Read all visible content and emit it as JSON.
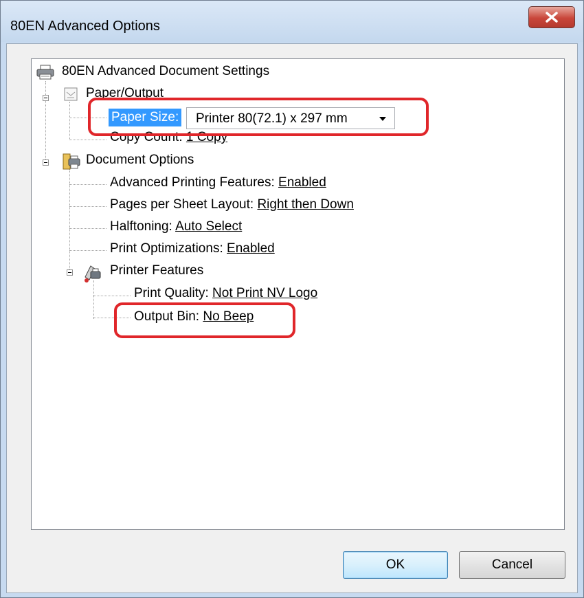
{
  "window": {
    "title": "80EN Advanced Options",
    "close_icon": "close-icon"
  },
  "tree": {
    "root": {
      "label": "80EN Advanced Document Settings",
      "icon": "printer-icon"
    },
    "paper_output": {
      "label": "Paper/Output",
      "icon": "paper-icon",
      "paper_size": {
        "label": "Paper Size:",
        "value": "Printer 80(72.1) x 297 mm"
      },
      "copy_count": {
        "label": "Copy Count:",
        "value": "1 Copy"
      }
    },
    "document_options": {
      "label": "Document Options",
      "icon": "document-options-icon",
      "items": [
        {
          "label": "Advanced Printing Features:",
          "value": "Enabled"
        },
        {
          "label": "Pages per Sheet Layout:",
          "value": "Right then Down"
        },
        {
          "label": "Halftoning:",
          "value": "Auto Select"
        },
        {
          "label": "Print Optimizations:",
          "value": "Enabled"
        }
      ],
      "printer_features": {
        "label": "Printer Features",
        "icon": "printer-features-icon",
        "items": [
          {
            "label": "Print Quality:",
            "value": "Not Print NV Logo"
          },
          {
            "label": "Output Bin:",
            "value": "No Beep"
          }
        ]
      }
    }
  },
  "buttons": {
    "ok": "OK",
    "cancel": "Cancel"
  },
  "colors": {
    "annotation": "#e0262a",
    "selection": "#3399ff"
  }
}
